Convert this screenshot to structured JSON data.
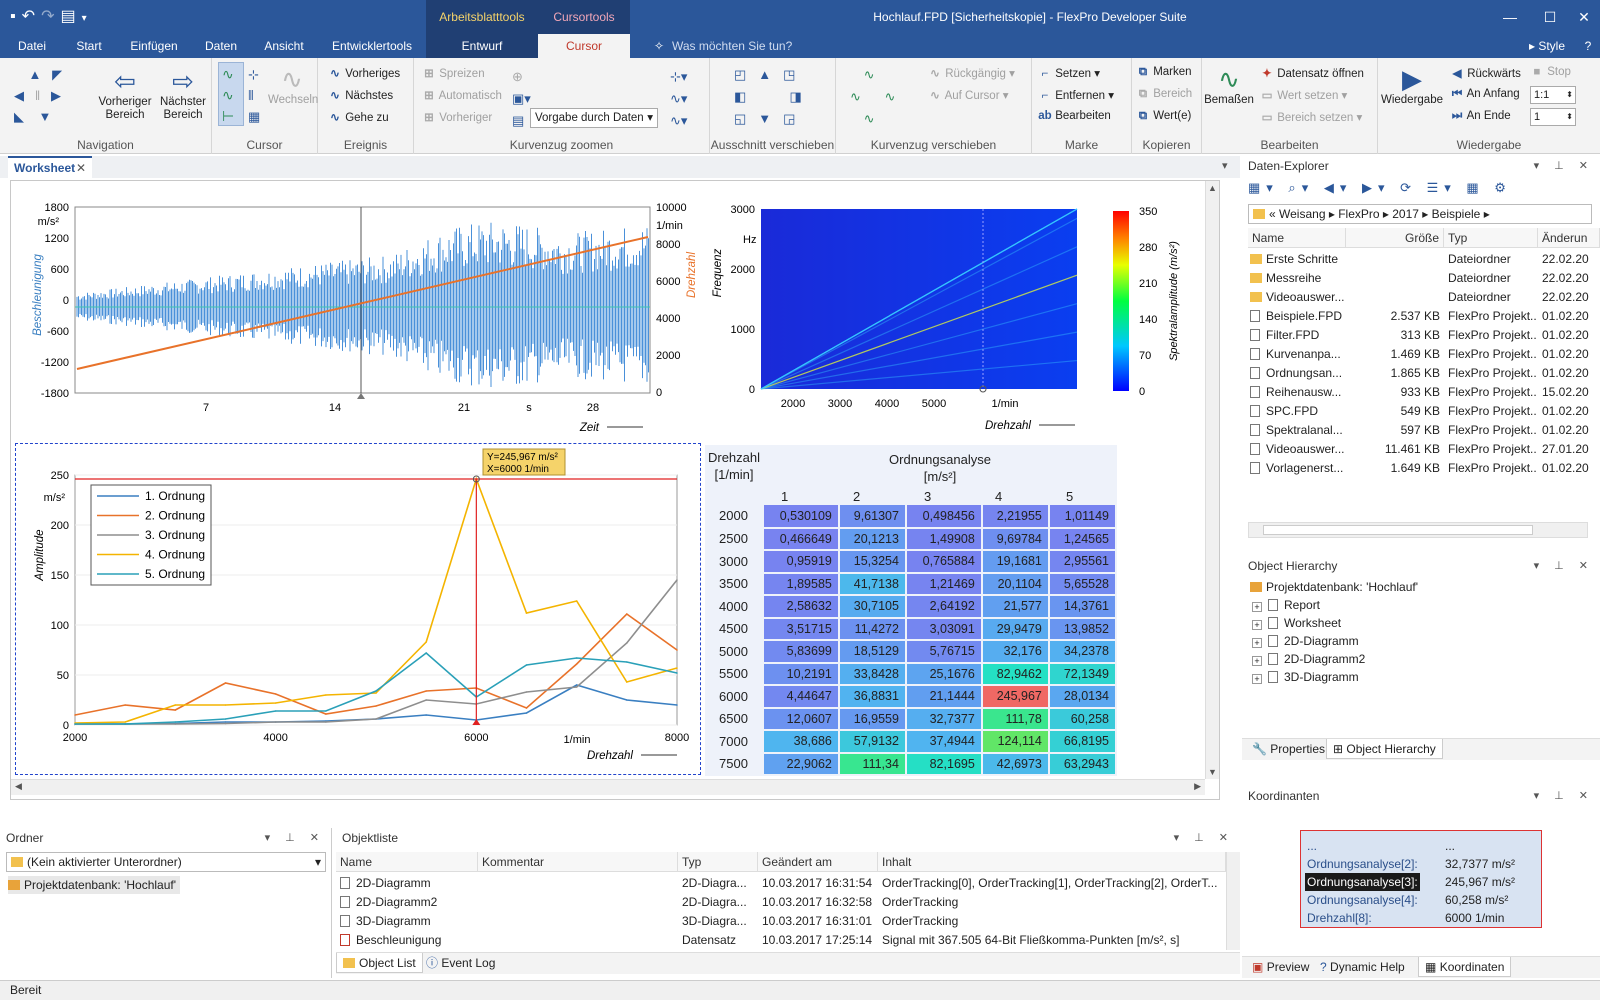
{
  "app": {
    "window_title": "Hochlauf.FPD [Sicherheitskopie] - FlexPro Developer Suite",
    "context_group_1": "Arbeitsblatttools",
    "context_group_2": "Cursortools",
    "style_label": "Style"
  },
  "menu": {
    "tabs": [
      "Datei",
      "Start",
      "Einfügen",
      "Daten",
      "Ansicht",
      "Entwicklertools"
    ],
    "context_tab_1": "Entwurf",
    "context_tab_2": "Cursor",
    "search_placeholder": "Was möchten Sie tun?"
  },
  "ribbon": {
    "navigation": {
      "name": "Navigation",
      "prev_area": "Vorheriger Bereich",
      "next_area": "Nächster Bereich"
    },
    "cursor": {
      "name": "Cursor",
      "switch": "Wechseln"
    },
    "event": {
      "name": "Ereignis",
      "prev": "Vorheriges",
      "next": "Nächstes",
      "goto": "Gehe zu"
    },
    "zoom": {
      "name": "Kurvenzug zoomen",
      "spread": "Spreizen",
      "auto": "Automatisch",
      "prev": "Vorheriger",
      "preset": "Vorgabe durch Daten"
    },
    "shift_view": {
      "name": "Ausschnitt verschieben"
    },
    "shift_curve": {
      "name": "Kurvenzug verschieben",
      "undo": "Rückgängig",
      "to_cursor": "Auf Cursor"
    },
    "mark": {
      "name": "Marke",
      "set": "Setzen",
      "remove": "Entfernen",
      "edit": "Bearbeiten"
    },
    "copy": {
      "name": "Kopieren",
      "marks": "Marken",
      "area": "Bereich",
      "values": "Wert(e)"
    },
    "edit": {
      "name": "Bearbeiten",
      "measure": "Bemaßen",
      "open_dataset": "Datensatz öffnen",
      "set_value": "Wert setzen",
      "set_area": "Bereich setzen"
    },
    "playback": {
      "name": "Wiedergabe",
      "play": "Wiedergabe",
      "back": "Rückwärts",
      "stop": "Stop",
      "to_start": "An Anfang",
      "to_end": "An Ende",
      "speed": "1:1",
      "step": "1"
    }
  },
  "worksheet_tab": "Worksheet",
  "chart1": {
    "y1_label": "Beschleunigung",
    "y1_unit": "m/s²",
    "y2_label": "Drehzahl",
    "y2_unit": "1/min",
    "x_label": "Zeit",
    "x_unit": "s",
    "y1_ticks": [
      "1800",
      "1200",
      "600",
      "0",
      "-600",
      "-1200",
      "-1800"
    ],
    "y2_ticks": [
      "10000",
      "8000",
      "6000",
      "4000",
      "2000",
      "0"
    ],
    "x_ticks": [
      "7",
      "14",
      "21",
      "28"
    ]
  },
  "chart2": {
    "y_label": "Frequenz",
    "y_unit": "Hz",
    "x_label": "Drehzahl",
    "x_unit": "1/min",
    "colorbar_label": "Spektralamplitude (m/s²)",
    "y_ticks": [
      "3000",
      "2000",
      "1000",
      "0"
    ],
    "x_ticks": [
      "2000",
      "3000",
      "4000",
      "5000"
    ],
    "cb_ticks": [
      "350",
      "280",
      "210",
      "140",
      "70",
      "0"
    ]
  },
  "chart_data": {
    "type": "line",
    "y_label": "Amplitude",
    "y_unit": "m/s²",
    "x_label": "Drehzahl",
    "x_unit": "1/min",
    "xlim": [
      2000,
      8000
    ],
    "ylim": [
      0,
      250
    ],
    "x_ticks": [
      "2000",
      "4000",
      "6000",
      "8000"
    ],
    "y_ticks": [
      "250",
      "200",
      "150",
      "100",
      "50",
      "0"
    ],
    "tooltip_y": "Y=245,967 m/s²",
    "tooltip_x": "X=6000 1/min",
    "colors": [
      "#3a7fc1",
      "#e8722a",
      "#8e8e8e",
      "#f4b400",
      "#2aa0b8"
    ],
    "x": [
      2000,
      2500,
      3000,
      3500,
      4000,
      4500,
      5000,
      5500,
      6000,
      6500,
      7000,
      7500,
      8000
    ],
    "series": [
      {
        "name": "1. Ordnung",
        "values": [
          1,
          1,
          1.5,
          3,
          3,
          4,
          6,
          10,
          5,
          12,
          40,
          25,
          20
        ]
      },
      {
        "name": "2. Ordnung",
        "values": [
          10,
          20,
          15,
          42,
          31,
          11,
          19,
          34,
          37,
          17,
          61,
          111,
          75
        ]
      },
      {
        "name": "3. Ordnung",
        "values": [
          1,
          1,
          1,
          1.5,
          3,
          3,
          6,
          25,
          21,
          33,
          38,
          82,
          145
        ]
      },
      {
        "name": "4. Ordnung",
        "values": [
          2,
          3,
          20,
          20,
          22,
          30,
          32,
          83,
          246,
          112,
          124,
          43,
          57
        ]
      },
      {
        "name": "5. Ordnung",
        "values": [
          1,
          1,
          3,
          6,
          14,
          14,
          34,
          72,
          28,
          60,
          67,
          63,
          52
        ]
      }
    ]
  },
  "order_table": {
    "rpm_header": "Drehzahl",
    "rpm_unit": "[1/min]",
    "title": "Ordnungsanalyse",
    "unit": "[m/s²]",
    "cols": [
      "1",
      "2",
      "3",
      "4",
      "5"
    ],
    "rows": [
      {
        "rpm": "2000",
        "v": [
          "0,530109",
          "9,61307",
          "0,498456",
          "2,21955",
          "1,01149"
        ]
      },
      {
        "rpm": "2500",
        "v": [
          "0,466649",
          "20,1213",
          "1,49908",
          "9,69784",
          "1,24565"
        ]
      },
      {
        "rpm": "3000",
        "v": [
          "0,95919",
          "15,3254",
          "0,765884",
          "19,1681",
          "2,95561"
        ]
      },
      {
        "rpm": "3500",
        "v": [
          "1,89585",
          "41,7138",
          "1,21469",
          "20,1104",
          "5,65528"
        ]
      },
      {
        "rpm": "4000",
        "v": [
          "2,58632",
          "30,7105",
          "2,64192",
          "21,577",
          "14,3761"
        ]
      },
      {
        "rpm": "4500",
        "v": [
          "3,51715",
          "11,4272",
          "3,03091",
          "29,9479",
          "13,9852"
        ]
      },
      {
        "rpm": "5000",
        "v": [
          "5,83699",
          "18,5129",
          "5,76715",
          "32,176",
          "34,2378"
        ]
      },
      {
        "rpm": "5500",
        "v": [
          "10,2191",
          "33,8428",
          "25,1676",
          "82,9462",
          "72,1349"
        ]
      },
      {
        "rpm": "6000",
        "v": [
          "4,44647",
          "36,8831",
          "21,1444",
          "245,967",
          "28,0134"
        ]
      },
      {
        "rpm": "6500",
        "v": [
          "12,0607",
          "16,9559",
          "32,7377",
          "111,78",
          "60,258"
        ]
      },
      {
        "rpm": "7000",
        "v": [
          "38,686",
          "57,9132",
          "37,4944",
          "124,114",
          "66,8195"
        ]
      },
      {
        "rpm": "7500",
        "v": [
          "22,9062",
          "111,34",
          "82,1695",
          "42,6973",
          "63,2943"
        ]
      }
    ]
  },
  "data_explorer": {
    "title": "Daten-Explorer",
    "path": [
      "Weisang",
      "FlexPro",
      "2017",
      "Beispiele"
    ],
    "cols": [
      "Name",
      "Größe",
      "Typ",
      "Änderun"
    ],
    "files": [
      {
        "name": "Erste Schritte",
        "size": "",
        "type": "Dateiordner",
        "date": "22.02.20",
        "folder": true
      },
      {
        "name": "Messreihe",
        "size": "",
        "type": "Dateiordner",
        "date": "22.02.20",
        "folder": true
      },
      {
        "name": "Videoauswer...",
        "size": "",
        "type": "Dateiordner",
        "date": "22.02.20",
        "folder": true
      },
      {
        "name": "Beispiele.FPD",
        "size": "2.537 KB",
        "type": "FlexPro Projekt...",
        "date": "01.02.20"
      },
      {
        "name": "Filter.FPD",
        "size": "313 KB",
        "type": "FlexPro Projekt...",
        "date": "01.02.20"
      },
      {
        "name": "Kurvenanpa...",
        "size": "1.469 KB",
        "type": "FlexPro Projekt...",
        "date": "01.02.20"
      },
      {
        "name": "Ordnungsan...",
        "size": "1.865 KB",
        "type": "FlexPro Projekt...",
        "date": "01.02.20"
      },
      {
        "name": "Reihenausw...",
        "size": "933 KB",
        "type": "FlexPro Projekt...",
        "date": "15.02.20"
      },
      {
        "name": "SPC.FPD",
        "size": "549 KB",
        "type": "FlexPro Projekt...",
        "date": "01.02.20"
      },
      {
        "name": "Spektralanal...",
        "size": "597 KB",
        "type": "FlexPro Projekt...",
        "date": "01.02.20"
      },
      {
        "name": "Videoauswer...",
        "size": "11.461 KB",
        "type": "FlexPro Projekt...",
        "date": "27.01.20"
      },
      {
        "name": "Vorlagenerst...",
        "size": "1.649 KB",
        "type": "FlexPro Projekt...",
        "date": "01.02.20"
      }
    ]
  },
  "object_hierarchy": {
    "title": "Object Hierarchy",
    "root": "Projektdatenbank: 'Hochlauf'",
    "items": [
      "Report",
      "Worksheet",
      "2D-Diagramm",
      "2D-Diagramm2",
      "3D-Diagramm"
    ],
    "tab_properties": "Properties",
    "tab_hierarchy": "Object Hierarchy"
  },
  "coordinates": {
    "title": "Koordinanten",
    "rows": [
      {
        "k": "...",
        "v": "..."
      },
      {
        "k": "Ordnungsanalyse[2]:",
        "v": "32,7377 m/s²"
      },
      {
        "k": "Ordnungsanalyse[3]:",
        "v": "245,967 m/s²"
      },
      {
        "k": "Ordnungsanalyse[4]:",
        "v": "60,258 m/s²"
      },
      {
        "k": "Drehzahl[8]:",
        "v": "6000 1/min"
      }
    ],
    "tabs": [
      "Preview",
      "Dynamic Help",
      "Koordinaten"
    ]
  },
  "ordner": {
    "title": "Ordner",
    "select": "(Kein aktivierter Unterordner)",
    "root": "Projektdatenbank: 'Hochlauf'"
  },
  "objektliste": {
    "title": "Objektliste",
    "cols": [
      "Name",
      "Kommentar",
      "Typ",
      "Geändert am",
      "Inhalt"
    ],
    "rows": [
      {
        "name": "2D-Diagramm",
        "comment": "",
        "type": "2D-Diagra...",
        "date": "10.03.2017 16:31:54",
        "content": "OrderTracking[0], OrderTracking[1], OrderTracking[2], OrderT..."
      },
      {
        "name": "2D-Diagramm2",
        "comment": "",
        "type": "2D-Diagra...",
        "date": "10.03.2017 16:32:58",
        "content": "OrderTracking"
      },
      {
        "name": "3D-Diagramm",
        "comment": "",
        "type": "3D-Diagra...",
        "date": "10.03.2017 16:31:01",
        "content": "OrderTracking"
      },
      {
        "name": "Beschleunigung",
        "comment": "",
        "type": "Datensatz",
        "date": "10.03.2017 17:25:14",
        "content": "Signal mit 367.505 64-Bit Fließkomma-Punkten [m/s², s]"
      }
    ],
    "tabs": [
      "Object List",
      "Event Log"
    ]
  },
  "status": "Bereit"
}
